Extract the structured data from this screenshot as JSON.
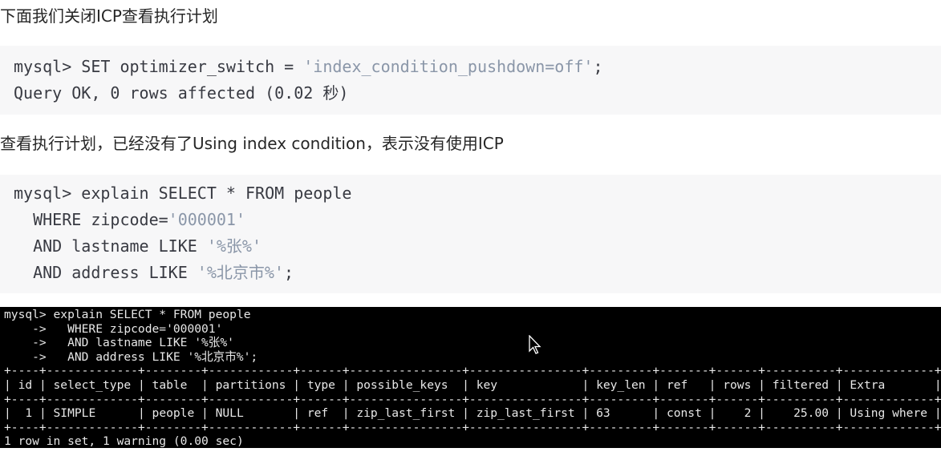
{
  "para1": "下面我们关闭ICP查看执行计划",
  "code1": {
    "line1_prefix": "mysql> SET optimizer_switch = ",
    "line1_string": "'index_condition_pushdown=off'",
    "line1_suffix": ";",
    "line2": "Query OK, 0 rows affected (0.02 秒)"
  },
  "para2": "查看执行计划，已经没有了Using index condition，表示没有使用ICP",
  "code2": {
    "line1": "mysql> explain SELECT * FROM people",
    "line2_prefix": "  WHERE zipcode=",
    "line2_string": "'000001'",
    "line3_prefix": "  AND lastname LIKE ",
    "line3_string": "'%张%'",
    "line4_prefix": "  AND address LIKE ",
    "line4_string": "'%北京市%'",
    "line4_suffix": ";"
  },
  "terminal": {
    "command_lines": [
      "mysql> explain SELECT * FROM people",
      "    ->   WHERE zipcode='000001'",
      "    ->   AND lastname LIKE '%张%'",
      "    ->   AND address LIKE '%北京市%';"
    ],
    "columns": [
      "id",
      "select_type",
      "table",
      "partitions",
      "type",
      "possible_keys",
      "key",
      "key_len",
      "ref",
      "rows",
      "filtered",
      "Extra"
    ],
    "rows": [
      [
        "1",
        "SIMPLE",
        "people",
        "NULL",
        "ref",
        "zip_last_first",
        "zip_last_first",
        "63",
        "const",
        "2",
        "25.00",
        "Using where"
      ]
    ],
    "footer": "1 row in set, 1 warning (0.00 sec)"
  },
  "colors": {
    "terminal_bg": "#000000",
    "code_bg": "#f7f7f8",
    "string": "#8a96a8"
  },
  "cursor_icon": "mouse-pointer-icon"
}
